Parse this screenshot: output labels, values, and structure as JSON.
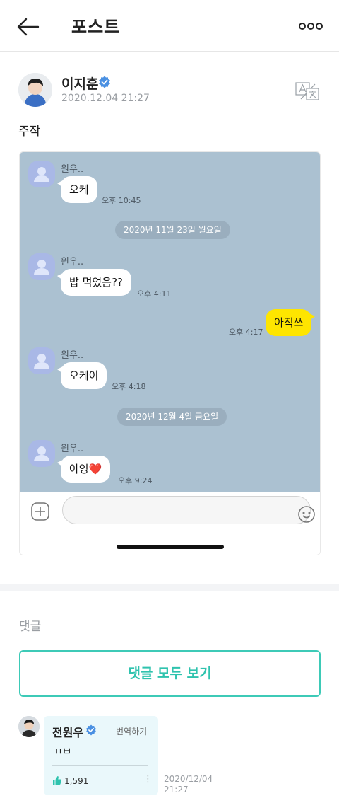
{
  "header": {
    "title": "포스트"
  },
  "post": {
    "author": "이지훈",
    "date": "2020.12.04 21:27",
    "text": "주작"
  },
  "chat": {
    "messages": [
      {
        "name": "원우..",
        "text": "오케",
        "time": "오후 10:45"
      },
      {
        "name": "원우..",
        "text": "밥 먹었음??",
        "time": "오후 4:11"
      },
      {
        "text": "아직쓰",
        "time": "오후 4:17"
      },
      {
        "name": "원우..",
        "text": "오케이",
        "time": "오후 4:18"
      },
      {
        "name": "원우..",
        "text": "아잉",
        "time": "오후 9:24"
      }
    ],
    "dates": [
      "2020년 11월 23일 월요일",
      "2020년 12월 4일 금요일"
    ],
    "heart": "❤️"
  },
  "comments": {
    "title": "댓글",
    "view_all_label": "댓글 모두 보기",
    "items": [
      {
        "author": "전원우",
        "translate_label": "번역하기",
        "text": "ㄲㅂ",
        "likes": "1,591",
        "date_line1": "2020/12/04",
        "date_line2": "21:27"
      }
    ]
  },
  "colors": {
    "accent": "#2fc3ae",
    "chat_bg": "#abc1d1",
    "my_bubble": "#fee500",
    "verified": "#4a90e2"
  }
}
